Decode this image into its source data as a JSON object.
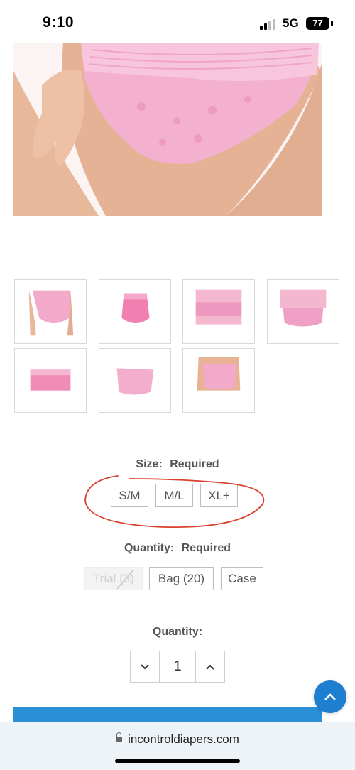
{
  "status_bar": {
    "time": "9:10",
    "network": "5G",
    "battery": "77"
  },
  "size_selector": {
    "label": "Size:",
    "required": "Required",
    "options": [
      "S/M",
      "M/L",
      "XL+"
    ]
  },
  "quantity_selector": {
    "label": "Quantity:",
    "required": "Required",
    "options": [
      "Trial (3)",
      "Bag (20)",
      "Case"
    ],
    "disabled_option": "Trial (3)"
  },
  "quantity_stepper": {
    "label": "Quantity:",
    "value": "1"
  },
  "browser": {
    "url": "incontroldiapers.com"
  },
  "colors": {
    "accent": "#2b8fd6",
    "annotation": "#d9412e",
    "product_pink": "#f2a6c8"
  }
}
